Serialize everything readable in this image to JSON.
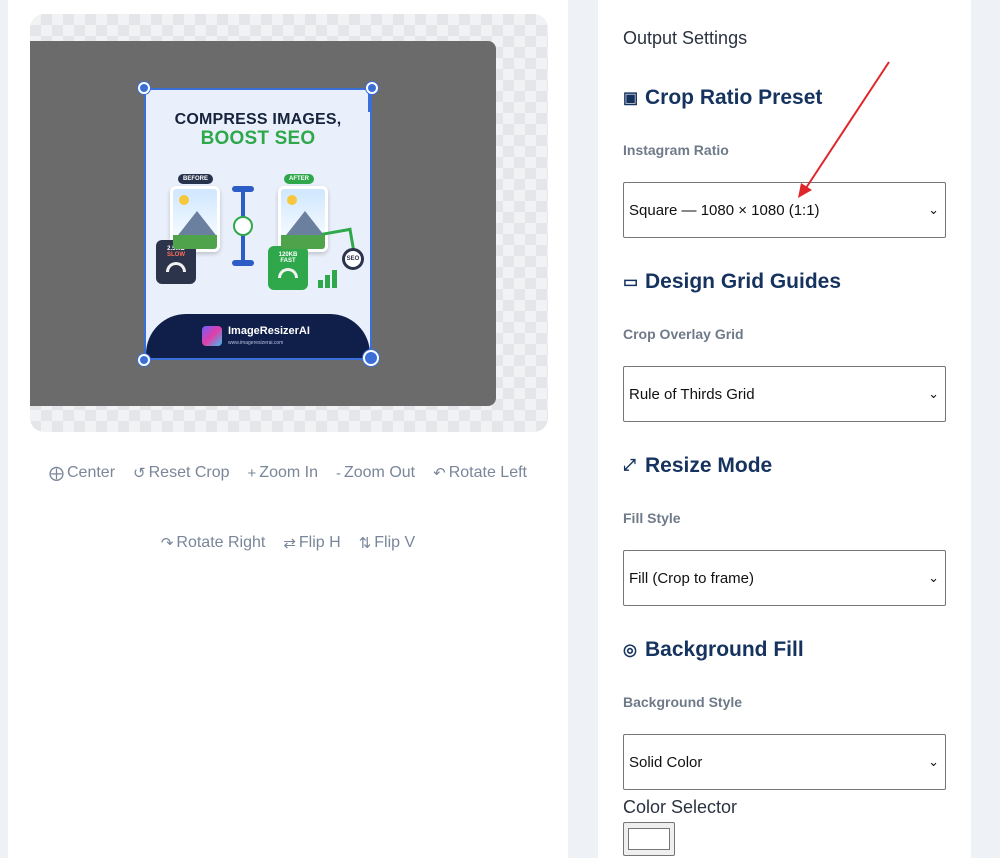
{
  "preview": {
    "headline_line1": "COMPRESS IMAGES,",
    "headline_line2": "BOOST SEO",
    "tag_before": "BEFORE",
    "tag_after": "AFTER",
    "size_before": "2.5MB",
    "speed_before": "SLOW",
    "size_after": "120KB",
    "speed_after": "FAST",
    "seo_badge": "SEO",
    "brand_name": "ImageResizerAI",
    "brand_url": "www.imageresizerai.com"
  },
  "toolbar": {
    "center": "Center",
    "reset_crop": "Reset Crop",
    "zoom_in": "Zoom In",
    "zoom_out": "Zoom Out",
    "rotate_left": "Rotate Left",
    "rotate_right": "Rotate Right",
    "flip_h": "Flip H",
    "flip_v": "Flip V"
  },
  "icons": {
    "center": "⨁",
    "reset_crop": "↺",
    "zoom_in": "+",
    "zoom_out": "-",
    "rotate_left": "↶",
    "rotate_right": "↷",
    "flip_h": "⇄",
    "flip_v": "⇅",
    "crop_ratio": "▣",
    "design_grid": "▭",
    "resize_mode": "⤢",
    "background_fill": "◎",
    "chevron": "⌄"
  },
  "settings": {
    "title": "Output Settings",
    "crop_ratio": {
      "heading": "Crop Ratio Preset",
      "label": "Instagram Ratio",
      "value": "Square — 1080 × 1080 (1:1)"
    },
    "design_grid": {
      "heading": "Design Grid Guides",
      "label": "Crop Overlay Grid",
      "value": "Rule of Thirds Grid"
    },
    "resize_mode": {
      "heading": "Resize Mode",
      "label": "Fill Style",
      "value": "Fill (Crop to frame)"
    },
    "background_fill": {
      "heading": "Background Fill",
      "label": "Background Style",
      "value": "Solid Color"
    },
    "color_selector": {
      "label": "Color Selector",
      "value": "#ffffff"
    }
  },
  "colors": {
    "heading": "#16335f",
    "accent_blue": "#3a6fd8",
    "accent_green": "#2ea84a",
    "annotation_arrow": "#e0262b",
    "canvas_dark": "#6b6b6b"
  }
}
